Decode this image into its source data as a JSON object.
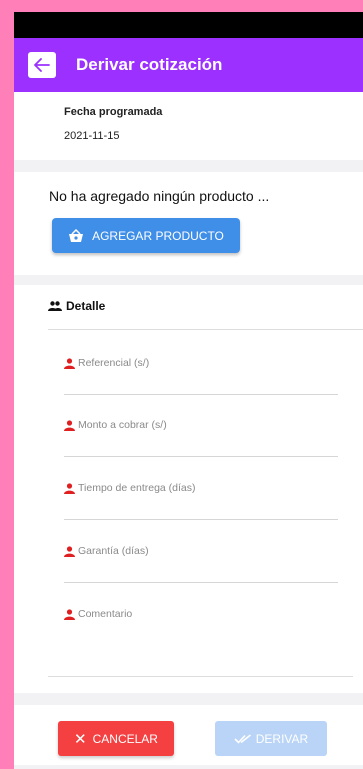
{
  "app_bar": {
    "title": "Derivar cotización"
  },
  "schedule": {
    "label": "Fecha programada",
    "value": "2021-11-15"
  },
  "products": {
    "empty_message": "No ha agregado ningún producto ...",
    "add_label": "AGREGAR PRODUCTO"
  },
  "detail": {
    "heading": "Detalle",
    "fields": [
      {
        "label": "Referencial (s/)",
        "value": ""
      },
      {
        "label": "Monto a cobrar (s/)",
        "value": ""
      },
      {
        "label": "Tiempo de entrega (días)",
        "value": ""
      },
      {
        "label": "Garantía (días)",
        "value": ""
      },
      {
        "label": "Comentario",
        "value": ""
      }
    ]
  },
  "actions": {
    "cancel_label": "CANCELAR",
    "derive_label": "DERIVAR"
  },
  "colors": {
    "app_bar": "#9b30ff",
    "primary": "#3f8ee8",
    "danger": "#f44040",
    "disabled": "#b9d4f6",
    "required": "#e02020"
  },
  "icons": [
    "back-arrow-icon",
    "basket-icon",
    "group-icon",
    "person-icon",
    "close-icon",
    "double-check-icon"
  ]
}
